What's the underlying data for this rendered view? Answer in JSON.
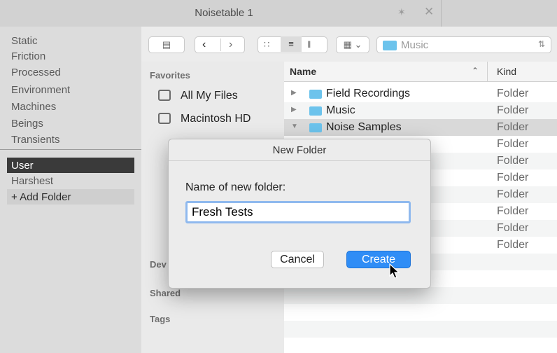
{
  "window": {
    "title": "Noisetable 1",
    "pin_icon": "pin-icon",
    "close_icon": "close-icon"
  },
  "left_panel": {
    "categories": [
      "Static",
      "Friction",
      "Processed",
      "Environment",
      "Machines",
      "Beings",
      "Transients"
    ],
    "user_items": [
      "User",
      "Harshest",
      "+ Add Folder"
    ]
  },
  "sheet": {
    "toolbar": {
      "view_sidebar_icon": "sidebar-toggle-icon",
      "back_icon": "chevron-left-icon",
      "forward_icon": "chevron-right-icon",
      "icon_view_icon": "grid-view-icon",
      "list_view_icon": "list-view-icon",
      "column_view_icon": "column-view-icon",
      "group_icon": "group-by-icon",
      "location": "Music"
    },
    "sidebar": {
      "favorites_header": "Favorites",
      "favorites": [
        "All My Files",
        "Macintosh HD"
      ],
      "devices_header": "Dev",
      "shared_header": "Shared",
      "tags_header": "Tags"
    },
    "list": {
      "col_name": "Name",
      "col_kind": "Kind",
      "rows": [
        {
          "name": "Field Recordings",
          "kind": "Folder"
        },
        {
          "name": "Music",
          "kind": "Folder"
        },
        {
          "name": "Noise Samples",
          "kind": "Folder"
        }
      ],
      "extra_kinds": [
        "Folder",
        "Folder",
        "Folder",
        "Folder",
        "Folder",
        "Folder",
        "Folder"
      ]
    }
  },
  "dialog": {
    "title": "New Folder",
    "prompt": "Name of new folder:",
    "value": "Fresh Tests",
    "cancel_label": "Cancel",
    "create_label": "Create"
  },
  "colors": {
    "accent": "#2f8df6",
    "folder": "#6cc3ec"
  }
}
